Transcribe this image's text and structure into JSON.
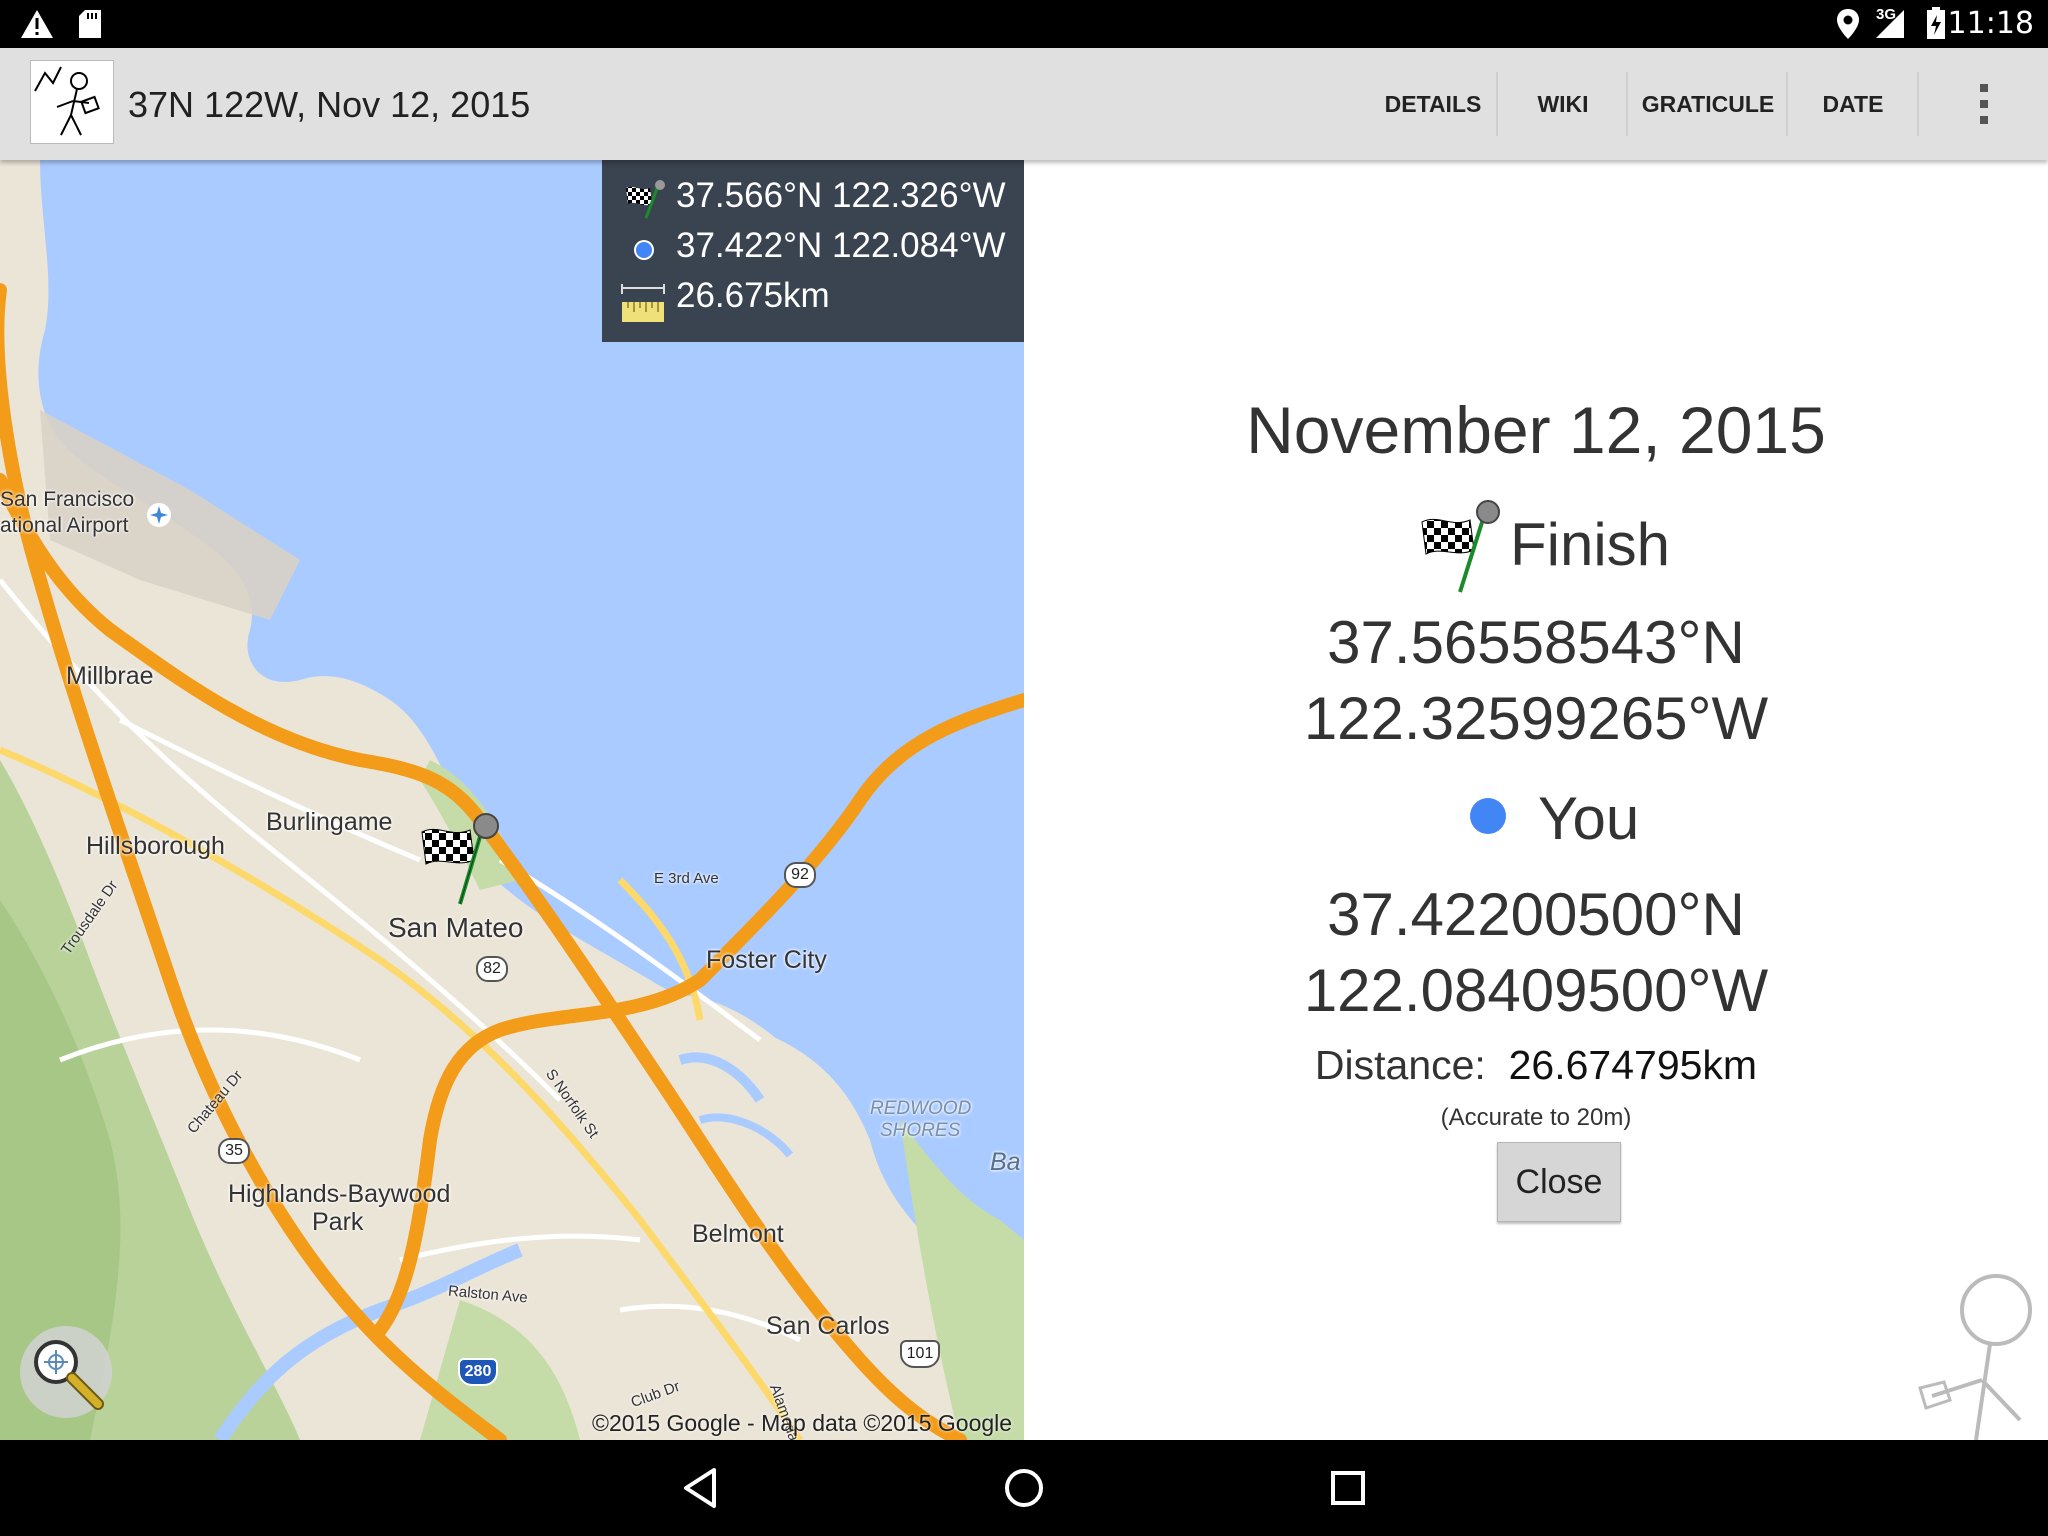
{
  "status_bar": {
    "time": "11:18",
    "network": "3G"
  },
  "action_bar": {
    "title": "37N 122W, Nov 12, 2015",
    "actions": [
      "DETAILS",
      "WIKI",
      "GRATICULE",
      "DATE"
    ],
    "overflow_icon": "more-vert-icon"
  },
  "map": {
    "info": {
      "finish_coords": "37.566°N 122.326°W",
      "you_coords": "37.422°N 122.084°W",
      "distance": "26.675km"
    },
    "labels": {
      "sfo": "San Francisco",
      "sfo2": "ational Airport",
      "millbrae": "Millbrae",
      "burlingame": "Burlingame",
      "hillsborough": "Hillsborough",
      "san_mateo": "San Mateo",
      "foster_city": "Foster City",
      "highlands": "Highlands-Baywood",
      "park": "Park",
      "belmont": "Belmont",
      "san_carlos": "San Carlos",
      "redwood": "REDWOOD",
      "shores": "SHORES",
      "e3rd": "E 3rd Ave",
      "norfolk": "S Norfolk St",
      "trousdale": "Trousdale Dr",
      "chateau": "Chateau Dr",
      "ralston": "Ralston Ave",
      "clubdr": "Club Dr",
      "alameda": "Alameda",
      "bay": "Ba",
      "hwy92": "92",
      "hwy82": "82",
      "hwy35": "35",
      "hwy280": "280",
      "hwy101": "101"
    },
    "copyright": "©2015 Google - Map data ©2015 Google"
  },
  "details": {
    "date": "November 12, 2015",
    "finish_label": "Finish",
    "finish_lat": "37.56558543°N",
    "finish_lon": "122.32599265°W",
    "you_label": "You",
    "you_lat": "37.42200500°N",
    "you_lon": "122.08409500°W",
    "distance_label": "Distance:",
    "distance_value": "26.674795km",
    "accuracy": "(Accurate to 20m)",
    "close_label": "Close"
  },
  "colors": {
    "you_dot": "#4285f4",
    "water": "#aacbff",
    "highway": "#f39c1a",
    "infobox": "#3a4350"
  }
}
